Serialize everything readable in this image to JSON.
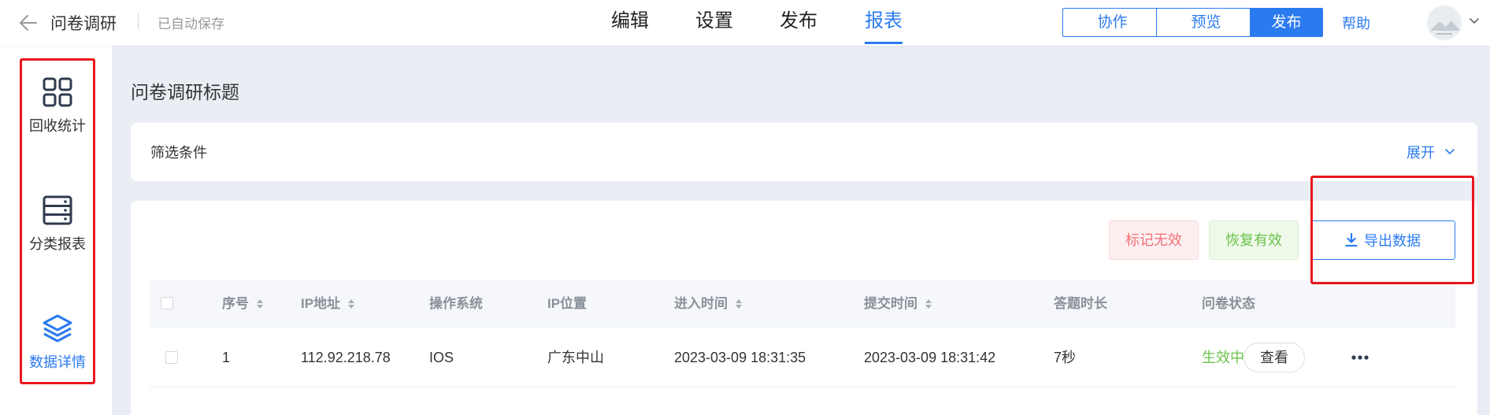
{
  "header": {
    "title": "问卷调研",
    "autosave": "已自动保存",
    "tabs": [
      {
        "label": "编辑",
        "active": false
      },
      {
        "label": "设置",
        "active": false
      },
      {
        "label": "发布",
        "active": false
      },
      {
        "label": "报表",
        "active": true
      }
    ],
    "collaborate_label": "协作",
    "preview_label": "预览",
    "publish_label": "发布",
    "help_label": "帮助"
  },
  "sidebar": {
    "items": [
      {
        "label": "回收统计",
        "icon": "grid-icon",
        "active": false
      },
      {
        "label": "分类报表",
        "icon": "server-list-icon",
        "active": false
      },
      {
        "label": "数据详情",
        "icon": "layers-icon",
        "active": true
      }
    ]
  },
  "main": {
    "page_title": "问卷调研标题",
    "filter": {
      "label": "筛选条件",
      "expand_label": "展开"
    },
    "actions": {
      "mark_invalid_label": "标记无效",
      "restore_valid_label": "恢复有效",
      "export_label": "导出数据"
    },
    "table": {
      "columns": [
        "序号",
        "IP地址",
        "操作系统",
        "IP位置",
        "进入时间",
        "提交时间",
        "答题时长",
        "问卷状态"
      ],
      "rows": [
        {
          "index": "1",
          "ip": "112.92.218.78",
          "os": "IOS",
          "location": "广东中山",
          "enter_time": "2023-03-09 18:31:35",
          "submit_time": "2023-03-09 18:31:42",
          "duration": "7秒",
          "status": "生效中",
          "view_label": "查看"
        }
      ]
    }
  },
  "colors": {
    "accent": "#2b7bf0",
    "highlight_box": "#e8171d",
    "status_active": "#6cc24a",
    "danger_text": "#f27277"
  }
}
